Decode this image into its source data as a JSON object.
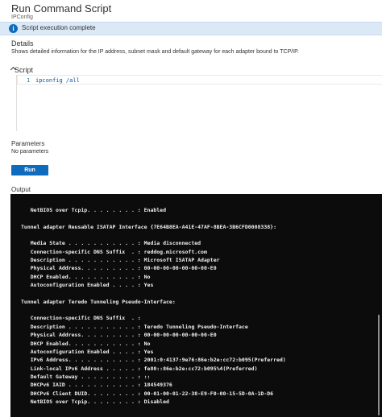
{
  "header": {
    "title": "Run Command Script",
    "subtitle": "IPConfig"
  },
  "banner": {
    "icon": "i",
    "message": "Script execution complete"
  },
  "details": {
    "heading": "Details",
    "text": "Shows detailed information for the IP address, subnet mask and default gateway for each adapter bound to TCP/IP."
  },
  "script": {
    "heading": "Script",
    "line_number": "1",
    "code": "ipconfig /all"
  },
  "parameters": {
    "heading": "Parameters",
    "text": "No parameters"
  },
  "run_button": {
    "label": "Run"
  },
  "output": {
    "heading": "Output",
    "lines": [
      "   NetBIOS over Tcpip. . . . . . . . : Enabled",
      "",
      "Tunnel adapter Reusable ISATAP Interface {7E64B8EA-A41E-47AF-8BEA-3B6CFD0008338}:",
      "",
      "   Media State . . . . . . . . . . . : Media disconnected",
      "   Connection-specific DNS Suffix  . : reddog.microsoft.com",
      "   Description . . . . . . . . . . . : Microsoft ISATAP Adapter",
      "   Physical Address. . . . . . . . . : 00-00-00-00-00-00-00-E0",
      "   DHCP Enabled. . . . . . . . . . . : No",
      "   Autoconfiguration Enabled . . . . : Yes",
      "",
      "Tunnel adapter Teredo Tunneling Pseudo-Interface:",
      "",
      "   Connection-specific DNS Suffix  . :",
      "   Description . . . . . . . . . . . : Teredo Tunneling Pseudo-Interface",
      "   Physical Address. . . . . . . . . : 00-00-00-00-00-00-00-E0",
      "   DHCP Enabled. . . . . . . . . . . : No",
      "   Autoconfiguration Enabled . . . . : Yes",
      "   IPv6 Address. . . . . . . . . . . : 2001:0:4137:9e76:86e:b2e:cc72:b095(Preferred)",
      "   Link-local IPv6 Address . . . . . : fe80::86e:b2e:cc72:b095%4(Preferred)",
      "   Default Gateway . . . . . . . . . : ::",
      "   DHCPv6 IAID . . . . . . . . . . . : 184549376",
      "   DHCPv6 Client DUID. . . . . . . . : 00-01-00-01-22-38-E9-F0-00-15-5D-0A-1D-D6",
      "   NetBIOS over Tcpip. . . . . . . . : Disabled"
    ]
  }
}
